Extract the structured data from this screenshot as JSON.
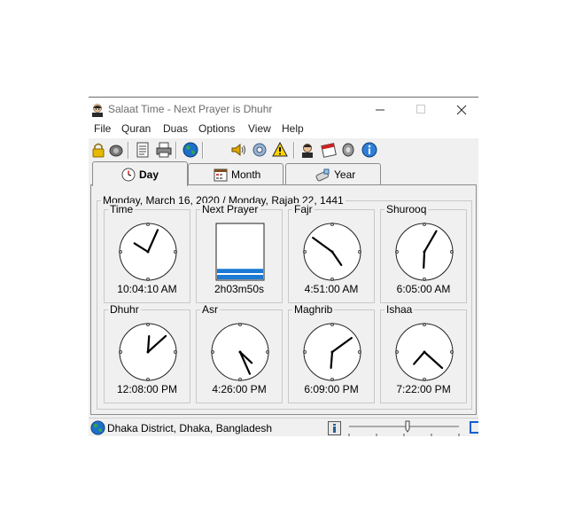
{
  "window": {
    "title": "Salaat Time - Next Prayer is Dhuhr"
  },
  "menu": [
    "File",
    "Quran",
    "Duas",
    "Options",
    "View",
    "Help"
  ],
  "toolbar_icons": [
    "lock-icon",
    "speaker-icon",
    "notes-icon",
    "print-icon",
    "globe-icon",
    "volume-icon",
    "settings-icon",
    "warning-icon",
    "person-icon",
    "calendar-icon",
    "audio-icon",
    "info-icon"
  ],
  "tabs": [
    {
      "label": "Day",
      "active": true
    },
    {
      "label": "Month",
      "active": false
    },
    {
      "label": "Year",
      "active": false
    }
  ],
  "date_header": "Monday, March 16, 2020 / Monday, Rajab 22, 1441",
  "clocks": [
    {
      "label": "Time",
      "time": "10:04:10 AM",
      "hour": 10,
      "minute": 4
    },
    {
      "label": "Next Prayer",
      "time": "2h03m50s",
      "progress": 0.2
    },
    {
      "label": "Fajr",
      "time": "4:51:00 AM",
      "hour": 4,
      "minute": 51
    },
    {
      "label": "Shurooq",
      "time": "6:05:00 AM",
      "hour": 6,
      "minute": 5
    },
    {
      "label": "Dhuhr",
      "time": "12:08:00 PM",
      "hour": 12,
      "minute": 8
    },
    {
      "label": "Asr",
      "time": "4:26:00 PM",
      "hour": 4,
      "minute": 26
    },
    {
      "label": "Maghrib",
      "time": "6:09:00 PM",
      "hour": 6,
      "minute": 9
    },
    {
      "label": "Ishaa",
      "time": "7:22:00 PM",
      "hour": 7,
      "minute": 22
    }
  ],
  "status": {
    "location": "Dhaka District, Dhaka, Bangladesh",
    "slider_value": 0.5
  }
}
